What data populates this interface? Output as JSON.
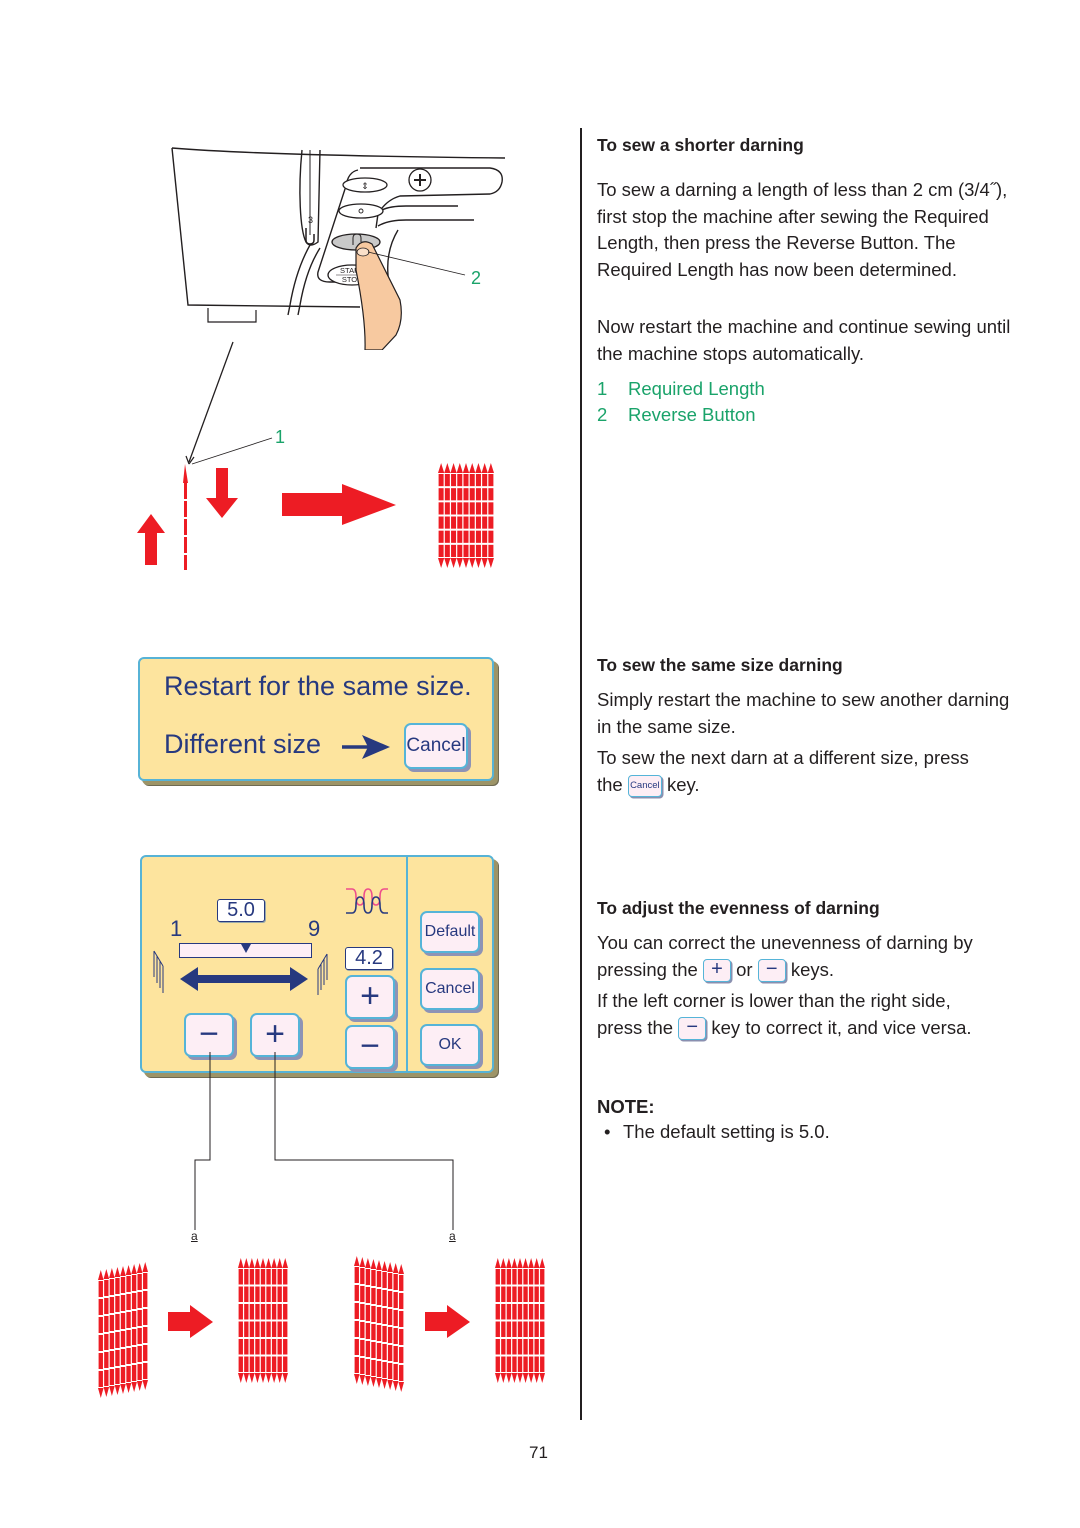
{
  "page": {
    "number": "71"
  },
  "illustration": {
    "machine": {
      "thread_guide_number": "3",
      "start_stop_label_top": "START",
      "start_stop_label_bottom": "STOP",
      "callout_reverse": "2"
    },
    "darning_sequence": {
      "callout_required_length": "1"
    },
    "restart_panel": {
      "line1": "Restart for the same size.",
      "line2": "Different size",
      "cancel_label": "Cancel"
    },
    "settings_panel": {
      "length_value": "5.0",
      "scale_min": "1",
      "scale_max": "9",
      "slider_position_fraction": 0.5,
      "evenness_value": "4.2",
      "plus_label": "+",
      "minus_label": "−",
      "default_label": "Default",
      "cancel_label": "Cancel",
      "ok_label": "OK"
    },
    "evenness_examples": {
      "label_left": "a",
      "label_right": "a"
    }
  },
  "sections": [
    {
      "heading": "To sew a shorter darning",
      "paragraphs": [
        "To sew a darning a length of less than 2 cm (3/4˝), first stop the machine after sewing the Required Length, then press the Reverse Button. The Required Length has now been determined.",
        "Now restart the machine and continue sewing until the machine stops automatically."
      ],
      "legend": [
        {
          "num": "1",
          "label": "Required Length"
        },
        {
          "num": "2",
          "label": "Reverse Button"
        }
      ]
    },
    {
      "heading": "To sew the same size darning",
      "paragraphs": [
        "Simply restart the machine to sew another darning in the same size.",
        "To sew the next darn at a different size, press"
      ],
      "para2_the": "the",
      "para2_key": "Cancel",
      "para2_end": "key."
    },
    {
      "heading": "To adjust the evenness of darning",
      "p1_line1": "You can correct the unevenness of darning by",
      "p1_start": "pressing the",
      "p1_key1": "+",
      "p1_or": "or",
      "p1_key2": "−",
      "p1_end": "keys.",
      "p2_line1": "If the left corner is lower than the right side,",
      "p2_start": "press the",
      "p2_key": "−",
      "p2_end": "key to correct it, and vice versa."
    }
  ],
  "note": {
    "title": "NOTE:",
    "items": [
      "The default setting is 5.0."
    ]
  },
  "colors": {
    "panel_bg": "#fde49e",
    "panel_border": "#57b3d6",
    "key_bg": "#fdeef5",
    "ui_text": "#27397f",
    "stitch_red": "#ed1c24",
    "callout_green": "#1aa36a"
  }
}
